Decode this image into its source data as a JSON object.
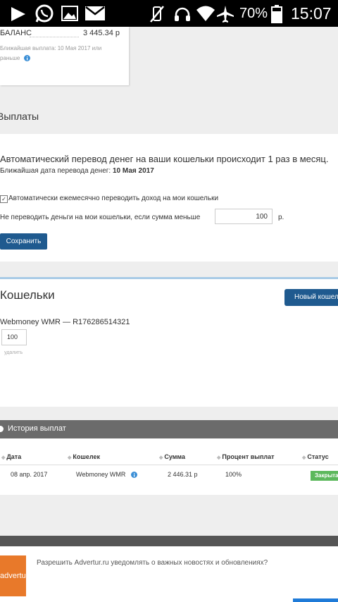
{
  "status_bar": {
    "battery_percent": "70%",
    "time": "15:07"
  },
  "balance": {
    "label": "БАЛАНС",
    "value": "3 445.34 р",
    "note": "Ближайшая выплата: 10 Мая 2017 или раньше"
  },
  "payouts": {
    "title": "Выплаты",
    "auto_text": "Автоматический перевод денег на ваши кошельки происходит 1 раз в месяц.",
    "next_date_label": "Ближайшая дата перевода денег:",
    "next_date_value": "10 Мая 2017",
    "auto_checkbox_label": "Автоматически ежемесячно переводить доход на мои кошельки",
    "auto_checkbox_checked": true,
    "threshold_label": "Не переводить деньги на мои кошельки, если сумма меньше",
    "threshold_value": "100",
    "threshold_unit": "р.",
    "save_label": "Сохранить"
  },
  "wallets": {
    "title": "Кошельки",
    "new_wallet_label": "Новый кошелек",
    "items": [
      {
        "name": "Webmoney WMR — R176286514321",
        "amount": "100",
        "delete_label": "удалить"
      }
    ]
  },
  "history": {
    "title": "История выплат",
    "columns": [
      "Дата",
      "Кошелек",
      "Сумма",
      "Процент выплат",
      "Статус"
    ],
    "rows": [
      {
        "date": "08 апр. 2017",
        "wallet": "Webmoney WMR",
        "amount": "2 446.31 р",
        "percent": "100%",
        "status": "Закрыта"
      }
    ]
  },
  "banner": {
    "logo_text": "advertur",
    "text": "Разрешить Advertur.ru уведомлять о важных новостях и обновлениях?"
  },
  "colors": {
    "primary_button": "#1f5a8f",
    "status_closed": "#5cb85c",
    "history_header": "#6b6b6b",
    "logo_orange": "#e8792a"
  }
}
